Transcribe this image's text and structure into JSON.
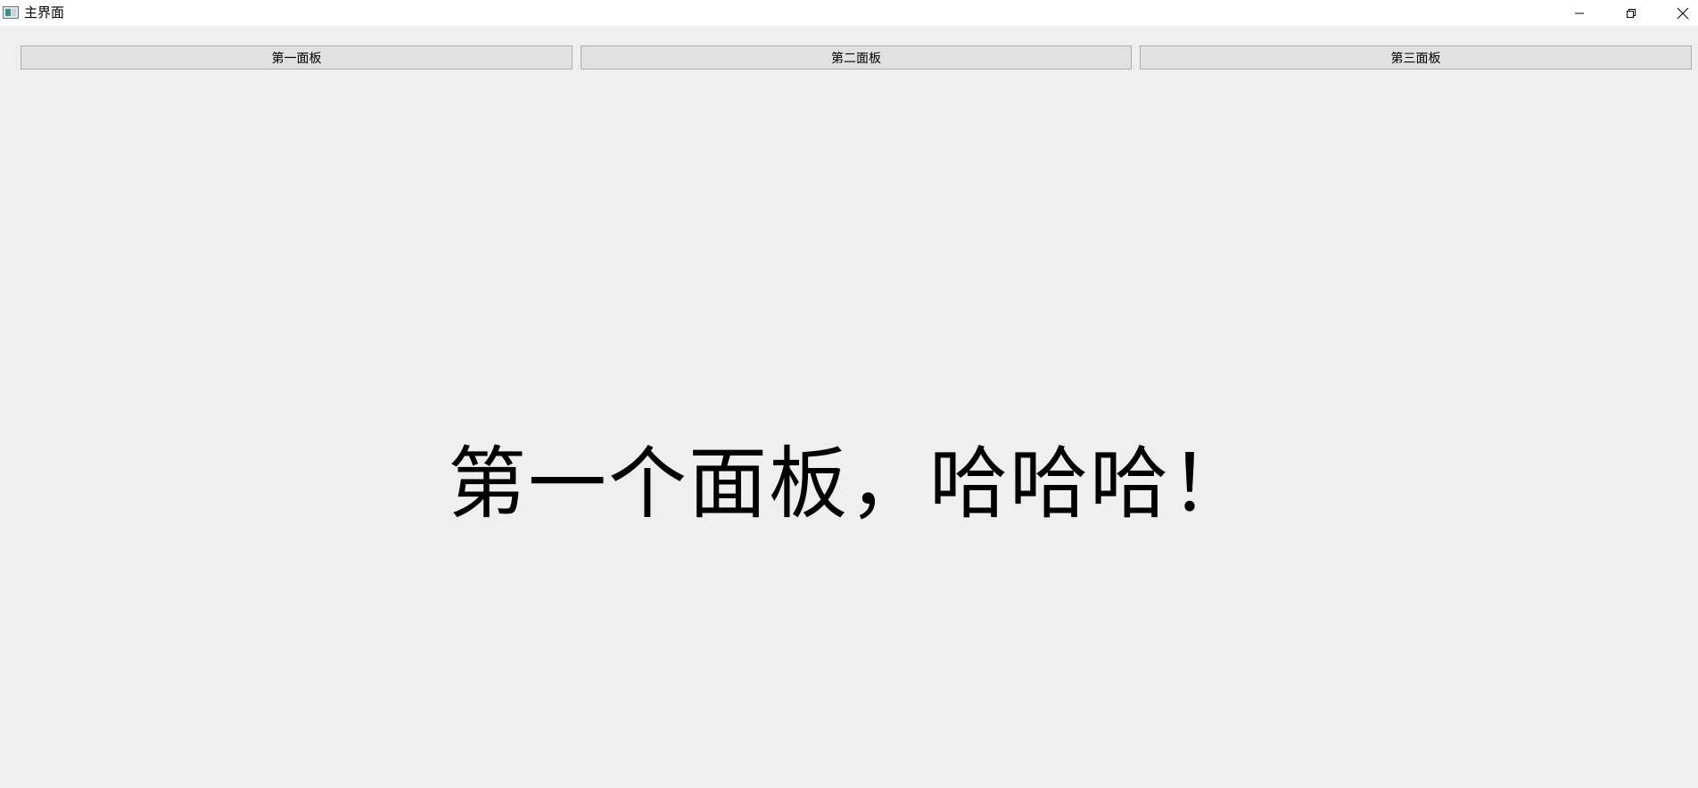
{
  "window": {
    "title": "主界面",
    "controls": {
      "minimize_icon": "minimize-icon",
      "restore_icon": "restore-icon",
      "close_icon": "close-icon"
    }
  },
  "tabs": [
    {
      "label": "第一面板"
    },
    {
      "label": "第二面板"
    },
    {
      "label": "第三面板"
    }
  ],
  "panel": {
    "message": "第一个面板，哈哈哈！"
  },
  "colors": {
    "background": "#efefef",
    "titlebar": "#ffffff",
    "button_face": "#e1e1e1",
    "button_border": "#adadad"
  }
}
